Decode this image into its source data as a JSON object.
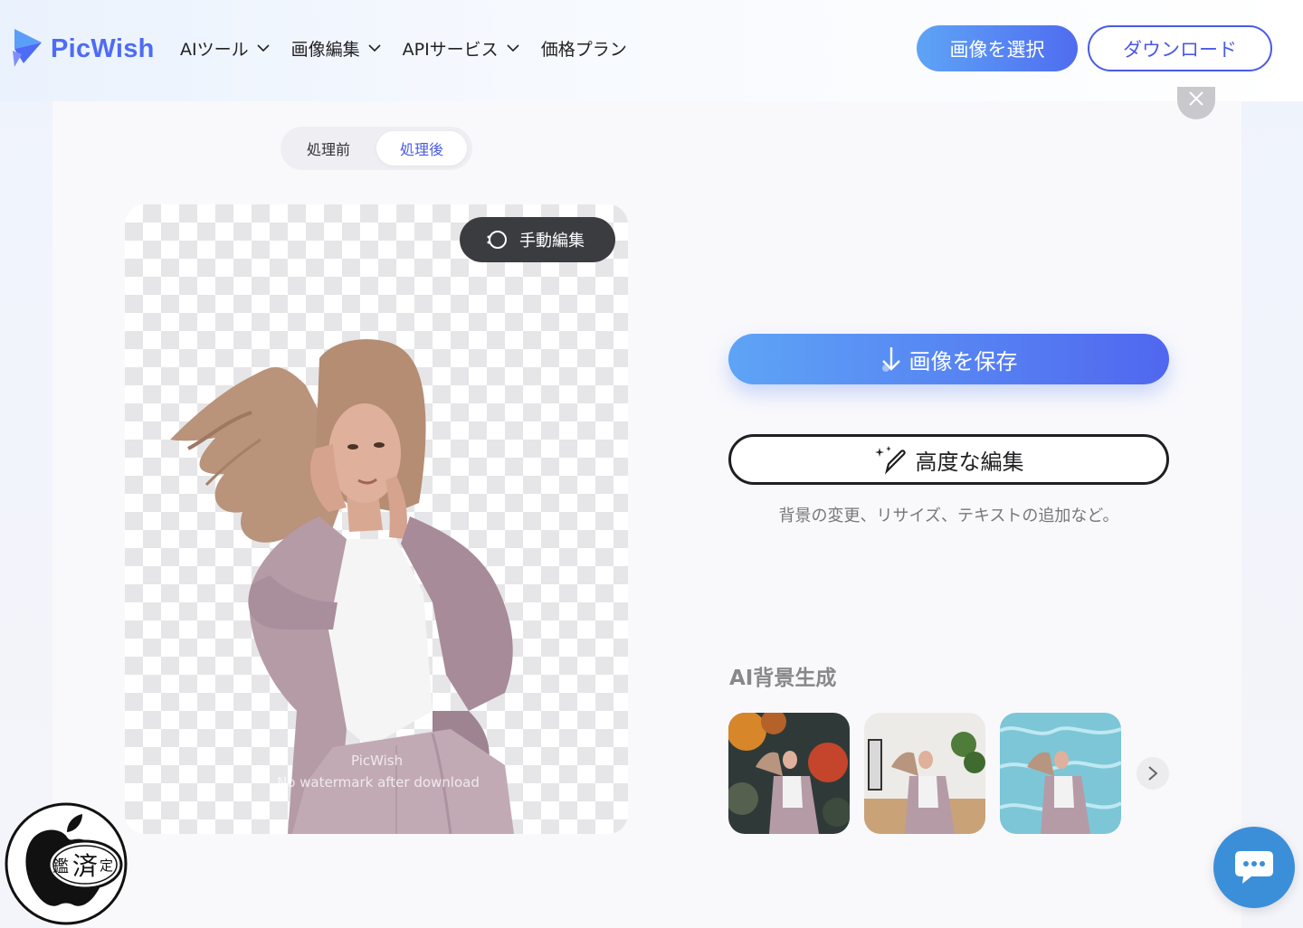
{
  "header": {
    "logo_text": "PicWish",
    "nav": [
      {
        "label": "AIツール",
        "has_dropdown": true
      },
      {
        "label": "画像編集",
        "has_dropdown": true
      },
      {
        "label": "APIサービス",
        "has_dropdown": true
      },
      {
        "label": "価格プラン",
        "has_dropdown": false
      }
    ],
    "select_image_label": "画像を選択",
    "download_label": "ダウンロード"
  },
  "toggle": {
    "before_label": "処理前",
    "after_label": "処理後",
    "active": "処理後"
  },
  "image": {
    "manual_edit_label": "手動編集",
    "watermark_brand": "PicWish",
    "watermark_note": "No watermark after download"
  },
  "actions": {
    "save_label": "画像を保存",
    "advanced_label": "高度な編集",
    "advanced_hint": "背景の変更、リサイズ、テキストの追加など。"
  },
  "ai_background": {
    "title": "AI背景生成",
    "thumbnails": [
      "autumn-bokeh-background",
      "living-room-background",
      "pool-water-background"
    ]
  },
  "badge": {
    "char_left": "鑑",
    "char_center": "済",
    "char_right": "定"
  },
  "colors": {
    "brand_blue": "#4e6bf5",
    "gradient_start": "#5ea4f6",
    "gradient_end": "#5067ef",
    "chat_blue": "#3b8fd9"
  },
  "icons": [
    "picwish-logo-icon",
    "chevron-down-icon",
    "close-icon",
    "lasso-icon",
    "download-arrow-icon",
    "magic-pen-icon",
    "chevron-right-icon",
    "chat-icon",
    "apple-logo-icon"
  ]
}
